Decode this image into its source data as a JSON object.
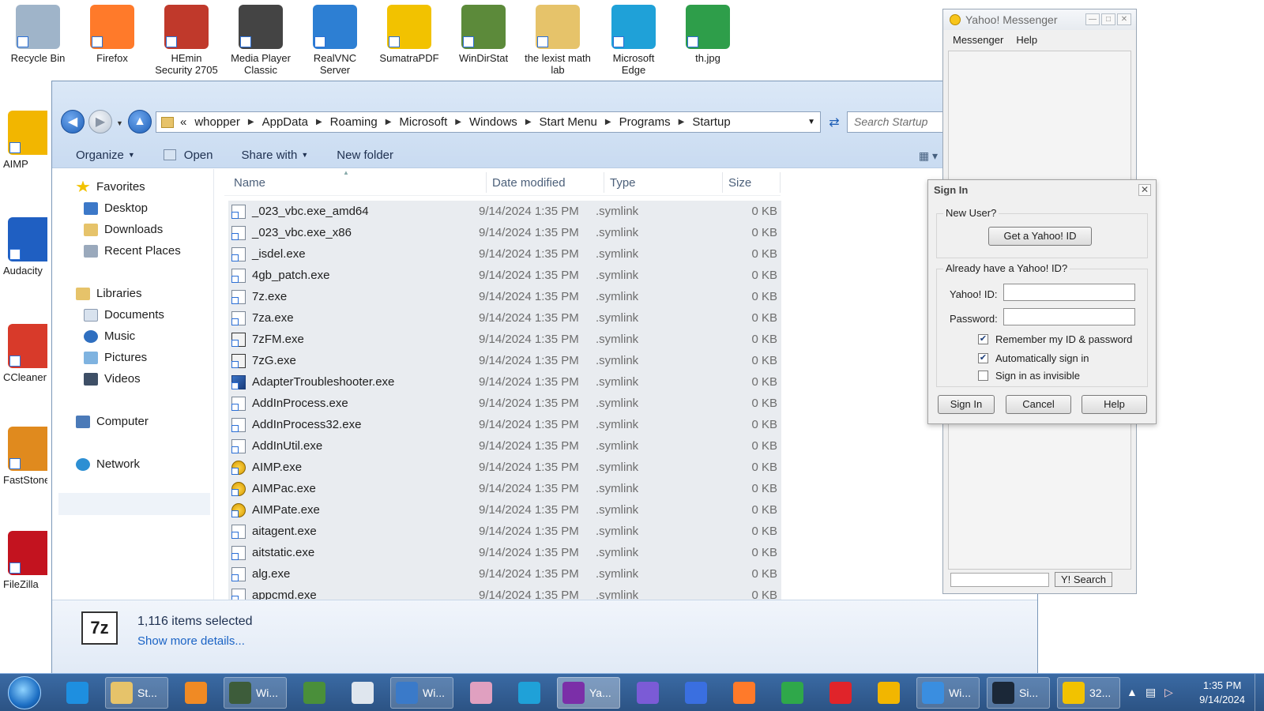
{
  "desktop": {
    "top_icons": [
      {
        "label": "Recycle Bin",
        "color": "#9fb4c9"
      },
      {
        "label": "Firefox",
        "color": "#ff7a2a"
      },
      {
        "label": "HEmin Security 2705",
        "color": "#c0392b"
      },
      {
        "label": "Media Player Classic",
        "color": "#444444"
      },
      {
        "label": "RealVNC Server",
        "color": "#2d7fd3"
      },
      {
        "label": "SumatraPDF",
        "color": "#f2c200"
      },
      {
        "label": "WinDirStat",
        "color": "#5c8a3a"
      },
      {
        "label": "the lexist math lab",
        "color": "#e6c36a"
      },
      {
        "label": "Microsoft Edge",
        "color": "#1fa1d8"
      },
      {
        "label": "th.jpg",
        "color": "#2e9e4a"
      }
    ],
    "left_icons": [
      {
        "label": "AIMP",
        "color": "#f2b600"
      },
      {
        "label": "Audacity",
        "color": "#1f5fc2"
      },
      {
        "label": "CCleaner",
        "color": "#d83a2a"
      },
      {
        "label": "FastStone Image Viewer",
        "color": "#e08a1e"
      },
      {
        "label": "FileZilla",
        "color": "#c3131f"
      }
    ]
  },
  "explorer": {
    "breadcrumb": [
      "«",
      "whopper",
      "AppData",
      "Roaming",
      "Microsoft",
      "Windows",
      "Start Menu",
      "Programs",
      "Startup"
    ],
    "search_placeholder": "Search Startup",
    "toolbar": {
      "organize": "Organize",
      "open": "Open",
      "share_with": "Share with",
      "new_folder": "New folder"
    },
    "nav": {
      "favorites": "Favorites",
      "desktop": "Desktop",
      "downloads": "Downloads",
      "recent_places": "Recent Places",
      "libraries": "Libraries",
      "documents": "Documents",
      "music": "Music",
      "pictures": "Pictures",
      "videos": "Videos",
      "computer": "Computer",
      "network": "Network"
    },
    "columns": {
      "name": "Name",
      "date": "Date modified",
      "type": "Type",
      "size": "Size"
    },
    "files": [
      {
        "name": "_023_vbc.exe_amd64",
        "date": "9/14/2024 1:35 PM",
        "type": ".symlink",
        "size": "0 KB",
        "icon": "file"
      },
      {
        "name": "_023_vbc.exe_x86",
        "date": "9/14/2024 1:35 PM",
        "type": ".symlink",
        "size": "0 KB",
        "icon": "file"
      },
      {
        "name": "_isdel.exe",
        "date": "9/14/2024 1:35 PM",
        "type": ".symlink",
        "size": "0 KB",
        "icon": "file"
      },
      {
        "name": "4gb_patch.exe",
        "date": "9/14/2024 1:35 PM",
        "type": ".symlink",
        "size": "0 KB",
        "icon": "file"
      },
      {
        "name": "7z.exe",
        "date": "9/14/2024 1:35 PM",
        "type": ".symlink",
        "size": "0 KB",
        "icon": "file"
      },
      {
        "name": "7za.exe",
        "date": "9/14/2024 1:35 PM",
        "type": ".symlink",
        "size": "0 KB",
        "icon": "file"
      },
      {
        "name": "7zFM.exe",
        "date": "9/14/2024 1:35 PM",
        "type": ".symlink",
        "size": "0 KB",
        "icon": "7z"
      },
      {
        "name": "7zG.exe",
        "date": "9/14/2024 1:35 PM",
        "type": ".symlink",
        "size": "0 KB",
        "icon": "7z"
      },
      {
        "name": "AdapterTroubleshooter.exe",
        "date": "9/14/2024 1:35 PM",
        "type": ".symlink",
        "size": "0 KB",
        "icon": "tool"
      },
      {
        "name": "AddInProcess.exe",
        "date": "9/14/2024 1:35 PM",
        "type": ".symlink",
        "size": "0 KB",
        "icon": "file"
      },
      {
        "name": "AddInProcess32.exe",
        "date": "9/14/2024 1:35 PM",
        "type": ".symlink",
        "size": "0 KB",
        "icon": "file"
      },
      {
        "name": "AddInUtil.exe",
        "date": "9/14/2024 1:35 PM",
        "type": ".symlink",
        "size": "0 KB",
        "icon": "file"
      },
      {
        "name": "AIMP.exe",
        "date": "9/14/2024 1:35 PM",
        "type": ".symlink",
        "size": "0 KB",
        "icon": "aimp"
      },
      {
        "name": "AIMPac.exe",
        "date": "9/14/2024 1:35 PM",
        "type": ".symlink",
        "size": "0 KB",
        "icon": "aimp"
      },
      {
        "name": "AIMPate.exe",
        "date": "9/14/2024 1:35 PM",
        "type": ".symlink",
        "size": "0 KB",
        "icon": "aimp"
      },
      {
        "name": "aitagent.exe",
        "date": "9/14/2024 1:35 PM",
        "type": ".symlink",
        "size": "0 KB",
        "icon": "file"
      },
      {
        "name": "aitstatic.exe",
        "date": "9/14/2024 1:35 PM",
        "type": ".symlink",
        "size": "0 KB",
        "icon": "file"
      },
      {
        "name": "alg.exe",
        "date": "9/14/2024 1:35 PM",
        "type": ".symlink",
        "size": "0 KB",
        "icon": "file"
      },
      {
        "name": "appcmd.exe",
        "date": "9/14/2024 1:35 PM",
        "type": ".symlink",
        "size": "0 KB",
        "icon": "file"
      }
    ],
    "details": {
      "icon_text": "7z",
      "selected": "1,116 items selected",
      "more": "Show more details..."
    }
  },
  "yahoo": {
    "title": "Yahoo! Messenger",
    "menu": [
      "Messenger",
      "Help"
    ],
    "search_button": "Y! Search",
    "signin": {
      "title": "Sign In",
      "new_user": "New User?",
      "get_id": "Get a Yahoo! ID",
      "already": "Already have a Yahoo! ID?",
      "id_label": "Yahoo! ID:",
      "password_label": "Password:",
      "remember": "Remember my ID & password",
      "auto": "Automatically sign in",
      "invisible": "Sign in as invisible",
      "sign_in": "Sign In",
      "cancel": "Cancel",
      "help": "Help",
      "remember_checked": true,
      "auto_checked": true,
      "invisible_checked": false
    }
  },
  "taskbar": {
    "items": [
      {
        "label": "",
        "color": "#1e8fe0",
        "wide": false
      },
      {
        "label": "St...",
        "color": "#e6c36a",
        "wide": true
      },
      {
        "label": "",
        "color": "#f08a24",
        "wide": false
      },
      {
        "label": "Wi...",
        "color": "#3d5c3a",
        "wide": true
      },
      {
        "label": "",
        "color": "#4a8f3a",
        "wide": false
      },
      {
        "label": "",
        "color": "#dfe6ee",
        "wide": false
      },
      {
        "label": "Wi...",
        "color": "#3a7ac9",
        "wide": true
      },
      {
        "label": "",
        "color": "#e0a0c0",
        "wide": false
      },
      {
        "label": "",
        "color": "#1fa1d8",
        "wide": false
      },
      {
        "label": "Ya...",
        "color": "#7b2fa8",
        "wide": true
      },
      {
        "label": "",
        "color": "#7b5bd6",
        "wide": false
      },
      {
        "label": "",
        "color": "#3a6fe0",
        "wide": false
      },
      {
        "label": "",
        "color": "#ff7a2a",
        "wide": false
      },
      {
        "label": "",
        "color": "#2fa84a",
        "wide": false
      },
      {
        "label": "",
        "color": "#e0242a",
        "wide": false
      },
      {
        "label": "",
        "color": "#f2b600",
        "wide": false
      },
      {
        "label": "Wi...",
        "color": "#3a8ee0",
        "wide": true
      },
      {
        "label": "Si...",
        "color": "#1b2838",
        "wide": true
      },
      {
        "label": "32...",
        "color": "#f2c200",
        "wide": true
      }
    ],
    "time": "1:35 PM",
    "date": "9/14/2024"
  }
}
